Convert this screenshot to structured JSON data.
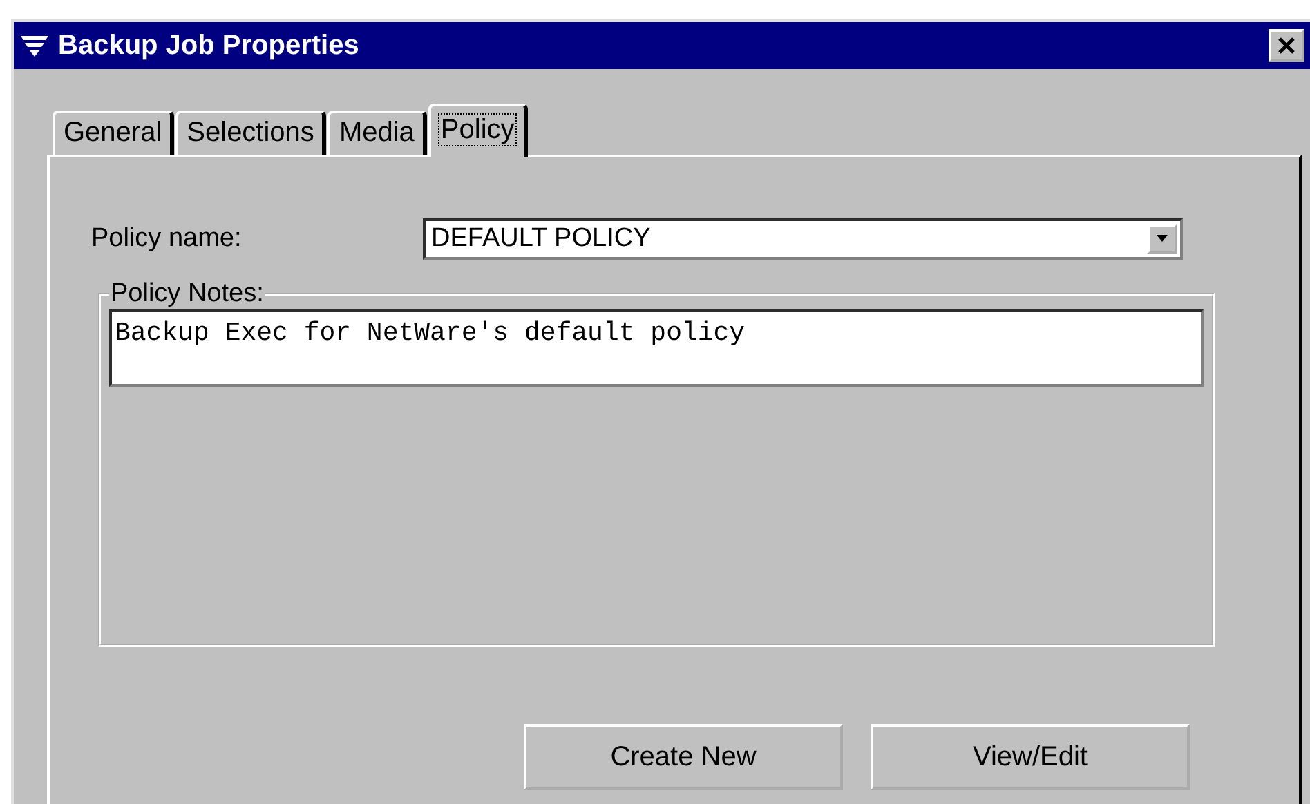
{
  "window": {
    "title": "Backup Job Properties"
  },
  "tabs": [
    {
      "label": "General",
      "selected": false
    },
    {
      "label": "Selections",
      "selected": false
    },
    {
      "label": "Media",
      "selected": false
    },
    {
      "label": "Policy",
      "selected": true
    }
  ],
  "policy_name": {
    "label": "Policy name:",
    "value": "DEFAULT POLICY"
  },
  "policy_notes": {
    "label": "Policy Notes:",
    "value": "Backup Exec for NetWare's default policy"
  },
  "buttons": [
    "Create New",
    "View/Edit"
  ]
}
